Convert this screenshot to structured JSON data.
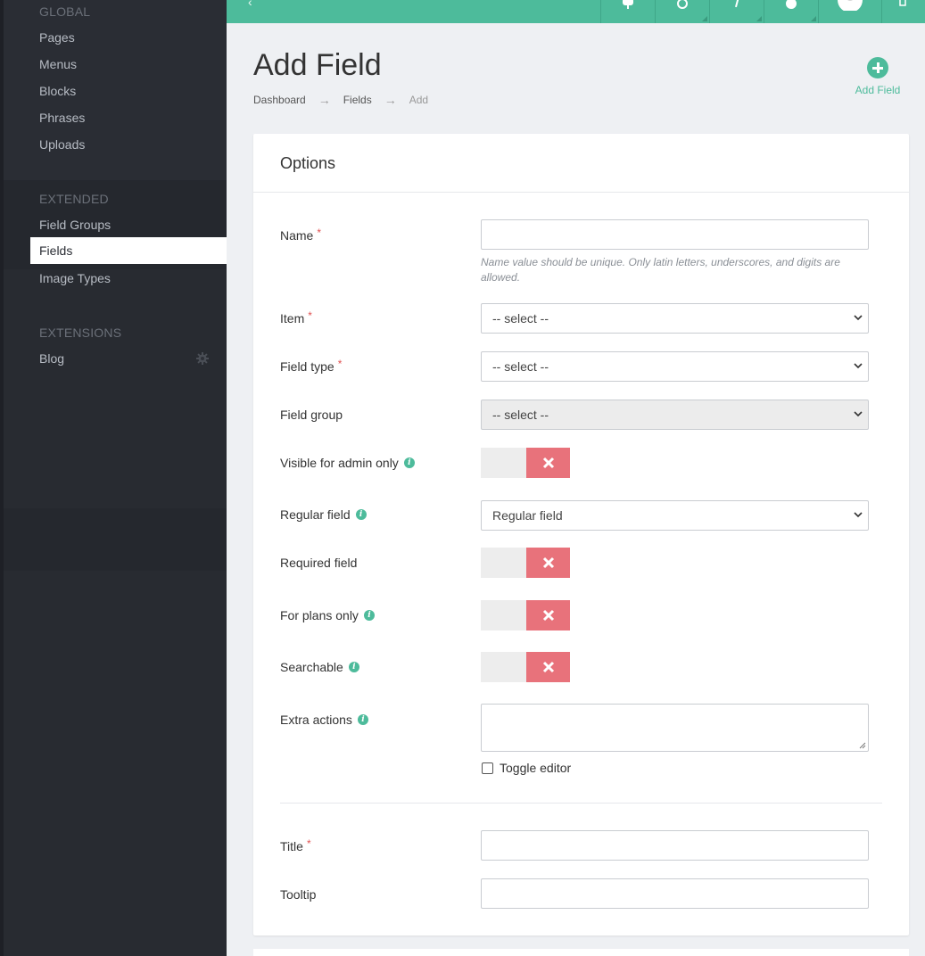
{
  "sidebar": {
    "sections": [
      {
        "heading": "GLOBAL",
        "items": [
          {
            "label": "Pages"
          },
          {
            "label": "Menus"
          },
          {
            "label": "Blocks"
          },
          {
            "label": "Phrases"
          },
          {
            "label": "Uploads"
          }
        ]
      },
      {
        "heading": "EXTENDED",
        "items": [
          {
            "label": "Field Groups"
          },
          {
            "label": "Fields",
            "active": true
          },
          {
            "label": "Image Types"
          }
        ]
      },
      {
        "heading": "EXTENSIONS",
        "items": [
          {
            "label": "Blog",
            "icon": "gear-icon"
          }
        ]
      }
    ]
  },
  "topbar": {
    "icons": [
      "cloud-icon",
      "history-icon",
      "edit-icon",
      "help-icon",
      "user-avatar",
      "logout-icon"
    ]
  },
  "header": {
    "title": "Add Field",
    "breadcrumb": [
      "Dashboard",
      "Fields",
      "Add"
    ],
    "action": {
      "label": "Add Field",
      "icon": "plus-circle-icon"
    }
  },
  "card": {
    "title": "Options",
    "fields": {
      "name": {
        "label": "Name",
        "required": true,
        "value": "",
        "help": "Name value should be unique. Only latin letters, underscores, and digits are allowed."
      },
      "item": {
        "label": "Item",
        "required": true,
        "selected": "-- select --"
      },
      "field_type": {
        "label": "Field type",
        "required": true,
        "selected": "-- select --"
      },
      "field_group": {
        "label": "Field group",
        "selected": "-- select --",
        "disabled": true
      },
      "visible_admin": {
        "label": "Visible for admin only",
        "info": true,
        "on": false
      },
      "regular_field": {
        "label": "Regular field",
        "info": true,
        "selected": "Regular field"
      },
      "required_field": {
        "label": "Required field",
        "on": false
      },
      "plans_only": {
        "label": "For plans only",
        "info": true,
        "on": false
      },
      "searchable": {
        "label": "Searchable",
        "info": true,
        "on": false
      },
      "extra_actions": {
        "label": "Extra actions",
        "info": true,
        "value": "",
        "toggle_editor": "Toggle editor"
      },
      "title": {
        "label": "Title",
        "required": true,
        "value": ""
      },
      "tooltip": {
        "label": "Tooltip",
        "value": ""
      }
    }
  },
  "colors": {
    "accent": "#4dbb9b",
    "sidebar": "#2e3138",
    "danger": "#e8727b",
    "required": "#e05252"
  }
}
